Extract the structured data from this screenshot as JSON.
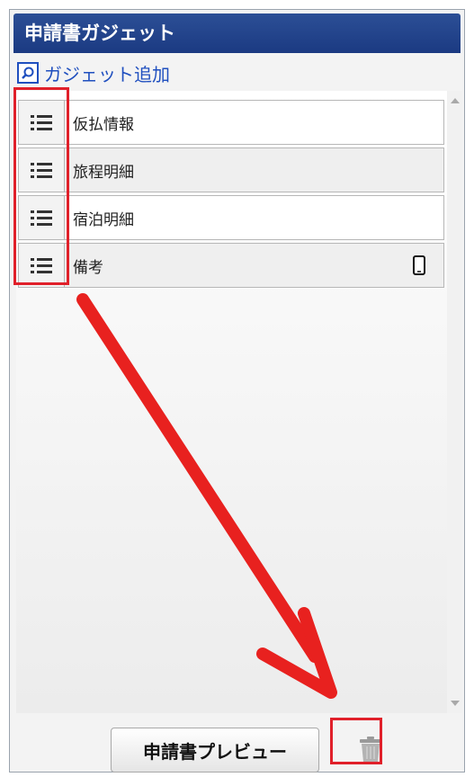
{
  "panel": {
    "title": "申請書ガジェット",
    "add_gadget_label": "ガジェット追加"
  },
  "gadgets": [
    {
      "label": "仮払情報",
      "row_style": "white",
      "icon": "drag-handle-icon"
    },
    {
      "label": "旅程明細",
      "row_style": "gray",
      "icon": "drag-handle-icon"
    },
    {
      "label": "宿泊明細",
      "row_style": "white",
      "icon": "drag-handle-icon"
    },
    {
      "label": "備考",
      "row_style": "gray",
      "icon": "drag-handle-icon",
      "extra_icon": "smartphone-icon"
    }
  ],
  "footer": {
    "preview_button_label": "申請書プレビュー",
    "trash_icon": "trash-icon"
  },
  "colors": {
    "header_bg": "#1b3a82",
    "link": "#1f4fbf",
    "highlight": "#e0202a",
    "arrow": "#e8211f"
  }
}
